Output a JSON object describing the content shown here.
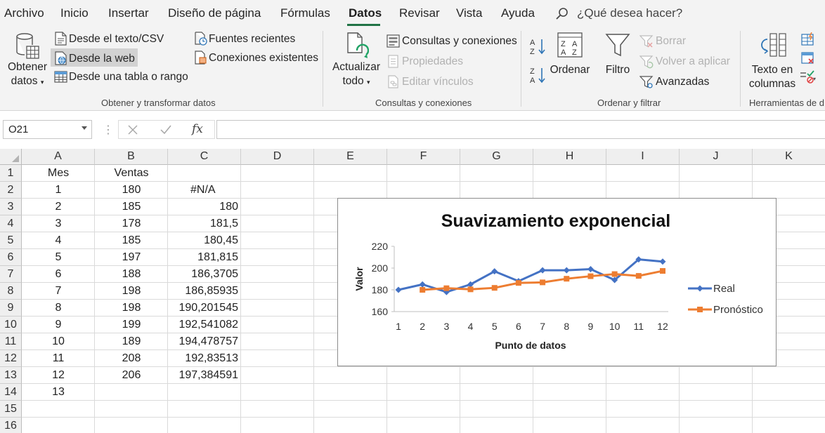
{
  "menu": {
    "tabs": [
      "Archivo",
      "Inicio",
      "Insertar",
      "Diseño de página",
      "Fórmulas",
      "Datos",
      "Revisar",
      "Vista",
      "Ayuda"
    ],
    "active_tab": "Datos",
    "search_placeholder": "¿Qué desea hacer?",
    "search_icon": "search-icon"
  },
  "ribbon": {
    "get_data": {
      "obtener_line1": "Obtener",
      "obtener_line2": "datos",
      "desde_texto": "Desde el texto/CSV",
      "desde_web": "Desde la web",
      "desde_tabla": "Desde una tabla o rango",
      "fuentes_recientes": "Fuentes recientes",
      "conexiones_existentes": "Conexiones existentes",
      "group_label": "Obtener y transformar datos"
    },
    "queries": {
      "actualizar_line1": "Actualizar",
      "actualizar_line2": "todo",
      "consultas": "Consultas y conexiones",
      "propiedades": "Propiedades",
      "editar_vinculos": "Editar vínculos",
      "group_label": "Consultas y conexiones"
    },
    "sort_filter": {
      "ordenar": "Ordenar",
      "filtro": "Filtro",
      "borrar": "Borrar",
      "volver_aplicar": "Volver a aplicar",
      "avanzadas": "Avanzadas",
      "group_label": "Ordenar y filtrar"
    },
    "tools": {
      "texto_line1": "Texto en",
      "texto_line2": "columnas",
      "group_label": "Herramientas de d"
    }
  },
  "formula_bar": {
    "name_box": "O21",
    "formula": ""
  },
  "grid": {
    "columns": [
      "A",
      "B",
      "C",
      "D",
      "E",
      "F",
      "G",
      "H",
      "I",
      "J",
      "K"
    ],
    "rows": [
      "1",
      "2",
      "3",
      "4",
      "5",
      "6",
      "7",
      "8",
      "9",
      "10",
      "11",
      "12",
      "13",
      "14",
      "15",
      "16"
    ],
    "headers": {
      "A": "Mes",
      "B": "Ventas"
    },
    "data": [
      {
        "mes": "1",
        "ventas": "180",
        "forecast": "#N/A"
      },
      {
        "mes": "2",
        "ventas": "185",
        "forecast": "180"
      },
      {
        "mes": "3",
        "ventas": "178",
        "forecast": "181,5"
      },
      {
        "mes": "4",
        "ventas": "185",
        "forecast": "180,45"
      },
      {
        "mes": "5",
        "ventas": "197",
        "forecast": "181,815"
      },
      {
        "mes": "6",
        "ventas": "188",
        "forecast": "186,3705"
      },
      {
        "mes": "7",
        "ventas": "198",
        "forecast": "186,85935"
      },
      {
        "mes": "8",
        "ventas": "198",
        "forecast": "190,201545"
      },
      {
        "mes": "9",
        "ventas": "199",
        "forecast": "192,541082"
      },
      {
        "mes": "10",
        "ventas": "189",
        "forecast": "194,478757"
      },
      {
        "mes": "11",
        "ventas": "208",
        "forecast": "192,83513"
      },
      {
        "mes": "12",
        "ventas": "206",
        "forecast": "197,384591"
      },
      {
        "mes": "13",
        "ventas": "",
        "forecast": ""
      }
    ]
  },
  "chart_data": {
    "type": "line",
    "title": "Suavizamiento exponencial",
    "xlabel": "Punto de datos",
    "ylabel": "Valor",
    "categories": [
      "1",
      "2",
      "3",
      "4",
      "5",
      "6",
      "7",
      "8",
      "9",
      "10",
      "11",
      "12"
    ],
    "ylim": [
      160,
      220
    ],
    "yticks": [
      "160",
      "180",
      "200",
      "220"
    ],
    "grid": false,
    "legend_position": "right",
    "series": [
      {
        "name": "Real",
        "color": "#4472C4",
        "marker": "diamond",
        "values": [
          180,
          185,
          178,
          185,
          197,
          188,
          198,
          198,
          199,
          189,
          208,
          206
        ]
      },
      {
        "name": "Pronóstico",
        "color": "#ED7D31",
        "marker": "square",
        "values": [
          null,
          180,
          181.5,
          180.45,
          181.815,
          186.3705,
          186.85935,
          190.201545,
          192.541082,
          194.478757,
          192.83513,
          197.384591
        ]
      }
    ]
  }
}
